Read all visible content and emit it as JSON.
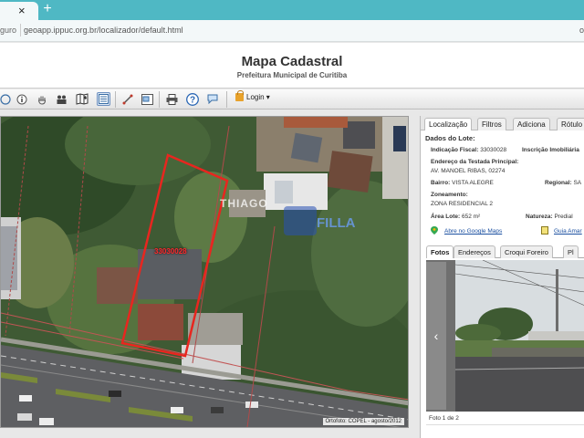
{
  "browser": {
    "tab_close": "×",
    "new_tab": "+",
    "address_prefix": "guro",
    "url": "geoapp.ippuc.org.br/localizador/default.html",
    "address_right": "o"
  },
  "header": {
    "title": "Mapa Cadastral",
    "subtitle": "Prefeitura Municipal de Curitiba"
  },
  "toolbar": {
    "help_icon": "?",
    "login_label": "Login ▾"
  },
  "map": {
    "lot_label": "33030028",
    "watermark_top": "THIAGO",
    "watermark_bottom": "FILLA",
    "credit": "Ortofoto: COPEL - agosto/2012"
  },
  "panel": {
    "tabs": [
      "Localização",
      "Filtros",
      "Adiciona",
      "Rótulo"
    ],
    "dados_title": "Dados do Lote:",
    "indicacao_label": "Indicação Fiscal:",
    "indicacao_value": "33030028",
    "inscricao_label": "Inscrição Imobiliária",
    "endereco_label": "Endereço da Testada Principal:",
    "endereco_value": "AV. MANOEL RIBAS, 02274",
    "bairro_label": "Bairro:",
    "bairro_value": "VISTA ALEGRE",
    "regional_label": "Regional:",
    "regional_value": "SA",
    "zoneamento_label": "Zoneamento:",
    "zoneamento_value": "ZONA RESIDENCIAL 2",
    "area_label": "Área Lote:",
    "area_value": "652 m²",
    "natureza_label": "Natureza:",
    "natureza_value": "Predial",
    "google_maps_link": "Abre no Google Maps",
    "guia_link": "Guia Amar",
    "foto_tabs": [
      "Fotos",
      "Endereços",
      "Croqui Foreiro",
      "Pl"
    ],
    "photo_prev": "‹",
    "photo_count": "Foto 1 de 2"
  }
}
